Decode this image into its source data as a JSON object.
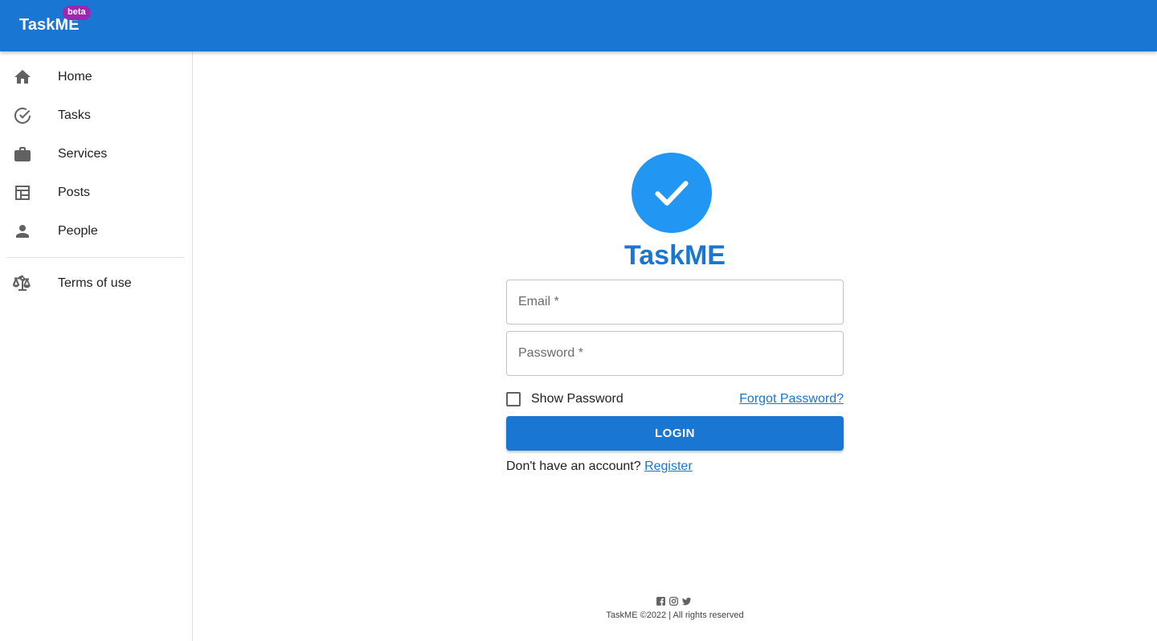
{
  "app": {
    "brand": "TaskME",
    "badge": "beta"
  },
  "sidebar": {
    "items": [
      {
        "label": "Home",
        "icon": "home-icon"
      },
      {
        "label": "Tasks",
        "icon": "check-circle-icon"
      },
      {
        "label": "Services",
        "icon": "briefcase-icon"
      },
      {
        "label": "Posts",
        "icon": "table-icon"
      },
      {
        "label": "People",
        "icon": "person-icon"
      }
    ],
    "secondary": [
      {
        "label": "Terms of use",
        "icon": "scale-icon"
      }
    ]
  },
  "login": {
    "title": "TaskME",
    "email_placeholder": "Email *",
    "password_placeholder": "Password *",
    "show_password_label": "Show Password",
    "forgot_password_label": "Forgot Password?",
    "login_button": "LOGIN",
    "register_prompt": "Don't have an account?",
    "register_link": "Register"
  },
  "footer": {
    "social_icons": [
      "facebook-icon",
      "instagram-icon",
      "twitter-icon"
    ],
    "text": "TaskME ©2022 | All rights reserved"
  },
  "colors": {
    "primary": "#1976d2",
    "logo_circle": "#2196f3",
    "beta_badge": "#9c27b0"
  }
}
